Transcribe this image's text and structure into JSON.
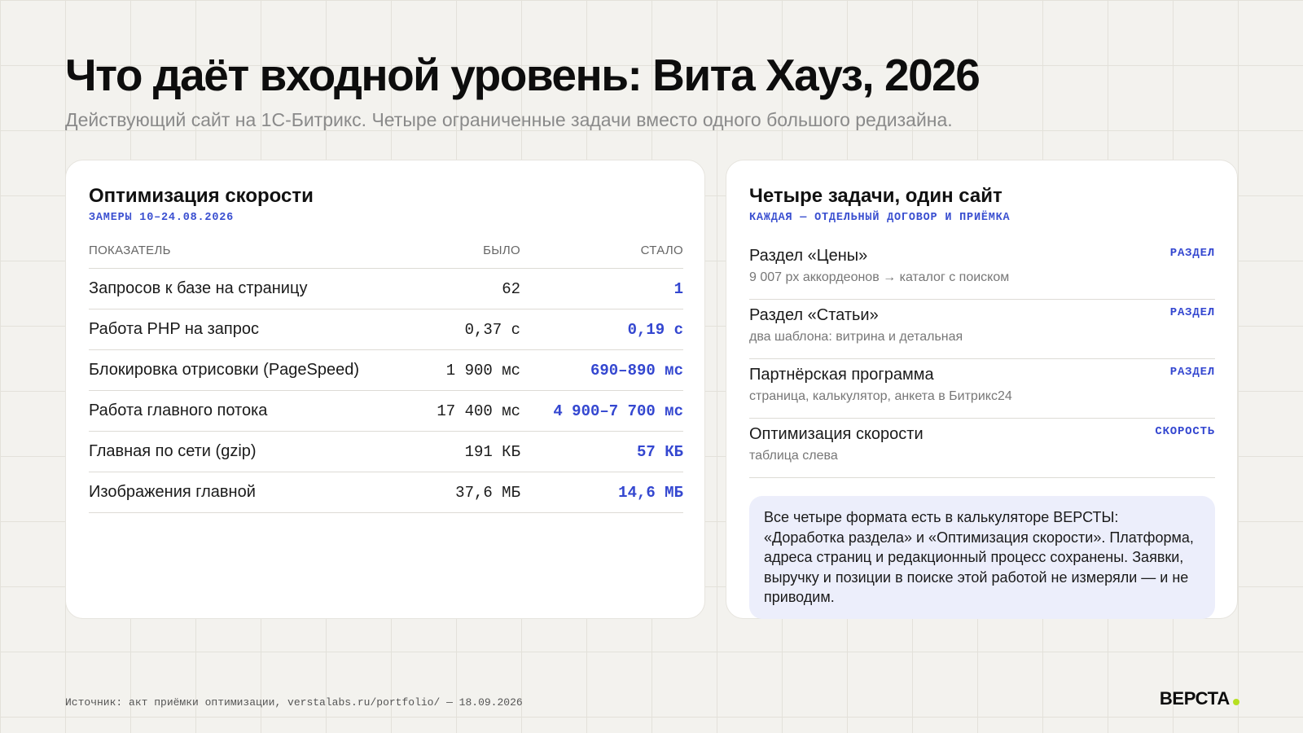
{
  "header": {
    "title": "Что даёт входной уровень: Вита Хауз, 2026",
    "subtitle": "Действующий сайт на 1С-Битрикс. Четыре ограниченные задачи вместо одного большого редизайна."
  },
  "speed_card": {
    "title": "Оптимизация скорости",
    "tag": "ЗАМЕРЫ 10–24.08.2026",
    "columns": {
      "metric": "ПОКАЗАТЕЛЬ",
      "before": "БЫЛО",
      "after": "СТАЛО"
    },
    "rows": [
      {
        "metric": "Запросов к базе на страницу",
        "before": "62",
        "after": "1"
      },
      {
        "metric": "Работа PHP на запрос",
        "before": "0,37 с",
        "after": "0,19 с"
      },
      {
        "metric": "Блокировка отрисовки (PageSpeed)",
        "before": "1 900 мс",
        "after": "690–890 мс"
      },
      {
        "metric": "Работа главного потока",
        "before": "17 400 мс",
        "after": "4 900–7 700 мс"
      },
      {
        "metric": "Главная по сети (gzip)",
        "before": "191 КБ",
        "after": "57 КБ"
      },
      {
        "metric": "Изображения главной",
        "before": "37,6 МБ",
        "after": "14,6 МБ"
      }
    ]
  },
  "tasks_card": {
    "title": "Четыре задачи, один сайт",
    "tag": "КАЖДАЯ — ОТДЕЛЬНЫЙ ДОГОВОР И ПРИЁМКА",
    "items": [
      {
        "name": "Раздел «Цены»",
        "desc": "9 007 px аккордеонов → каталог с поиском",
        "badge": "РАЗДЕЛ"
      },
      {
        "name": "Раздел «Статьи»",
        "desc": "два шаблона: витрина и детальная",
        "badge": "РАЗДЕЛ"
      },
      {
        "name": "Партнёрская программа",
        "desc": "страница, калькулятор, анкета в Битрикс24",
        "badge": "РАЗДЕЛ"
      },
      {
        "name": "Оптимизация скорости",
        "desc": "таблица слева",
        "badge": "СКОРОСТЬ"
      }
    ],
    "note": "Все четыре формата есть в калькуляторе ВЕРСТЫ: «Доработка раздела» и «Оптимизация скорости». Платформа, адреса страниц и редакционный процесс сохранены. Заявки, выручку и позиции в поиске этой работой не измеряли — и не приводим."
  },
  "footer": {
    "source": "Источник: акт приёмки оптимизации, verstalabs.ru/portfolio/ — 18.09.2026",
    "logo": "ВЕРСТА"
  },
  "colors": {
    "accent": "#3447d0",
    "logo_dot": "#b6e021",
    "note_bg": "#eceefb",
    "page_bg": "#f3f2ee"
  }
}
